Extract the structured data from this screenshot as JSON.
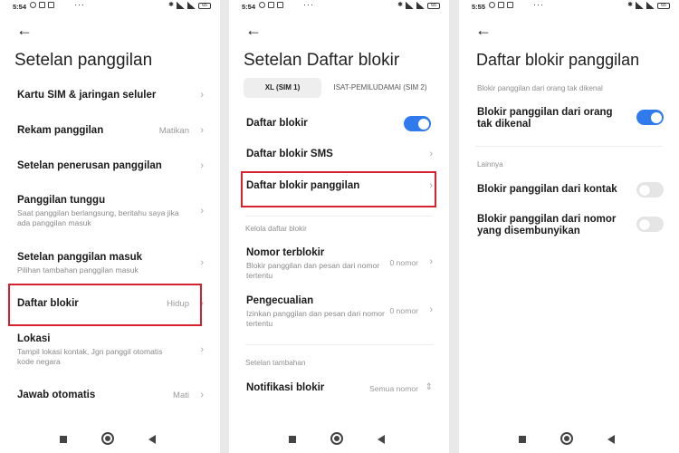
{
  "screen1": {
    "status": {
      "time": "5:54",
      "battery": "65"
    },
    "title": "Setelan panggilan",
    "items": [
      {
        "label": "Kartu SIM & jaringan seluler",
        "value": "",
        "sub": ""
      },
      {
        "label": "Rekam panggilan",
        "value": "Matikan",
        "sub": ""
      },
      {
        "label": "Setelan penerusan panggilan",
        "value": "",
        "sub": ""
      },
      {
        "label": "Panggilan tunggu",
        "value": "",
        "sub": "Saat panggilan berlangsung, beritahu saya jika ada panggilan masuk"
      },
      {
        "label": "Setelan panggilan masuk",
        "value": "",
        "sub": "Pilihan tambahan panggilan masuk"
      },
      {
        "label": "Daftar blokir",
        "value": "Hidup",
        "sub": ""
      },
      {
        "label": "Lokasi",
        "value": "",
        "sub": "Tampil lokasi kontak, Jgn panggil otomatis kode negara"
      },
      {
        "label": "Jawab otomatis",
        "value": "Mati",
        "sub": ""
      }
    ]
  },
  "screen2": {
    "status": {
      "time": "5:54",
      "battery": "65"
    },
    "title": "Setelan Daftar blokir",
    "tabs": [
      "XL (SIM 1)",
      "ISAT-PEMILUDAMAI (SIM 2)"
    ],
    "items": [
      {
        "label": "Daftar blokir",
        "value": "",
        "sub": "",
        "toggle": true
      },
      {
        "label": "Daftar blokir SMS",
        "value": "",
        "sub": ""
      },
      {
        "label": "Daftar blokir panggilan",
        "value": "",
        "sub": ""
      }
    ],
    "section1": "Kelola daftar blokir",
    "items2": [
      {
        "label": "Nomor terblokir",
        "value": "0 nomor",
        "sub": "Blokir panggilan dan pesan dari nomor tertentu"
      },
      {
        "label": "Pengecualian",
        "value": "0 nomor",
        "sub": "Izinkan panggilan dan pesan dari nomor tertentu"
      }
    ],
    "section2": "Setelan tambahan",
    "items3": [
      {
        "label": "Notifikasi blokir",
        "value": "Semua nomor",
        "sub": ""
      }
    ]
  },
  "screen3": {
    "status": {
      "time": "5:55",
      "battery": "65"
    },
    "title": "Daftar blokir panggilan",
    "section1": "Blokir panggilan dari orang tak dikenal",
    "items1": [
      {
        "label": "Blokir panggilan dari orang tak dikenal",
        "toggle": true
      }
    ],
    "section2": "Lainnya",
    "items2": [
      {
        "label": "Blokir panggilan dari kontak",
        "toggle": false
      },
      {
        "label": "Blokir panggilan dari nomor yang disembunyikan",
        "toggle": false
      }
    ]
  },
  "icons": {
    "back": "arrow-left-icon",
    "chevron": "chevron-right-icon",
    "updown": "chevron-updown-icon",
    "nav_recent": "square-icon",
    "nav_home": "circle-icon",
    "nav_back": "triangle-back-icon"
  },
  "colors": {
    "accent": "#2f7bed",
    "highlight": "#d7212f",
    "secondary_text": "#8a8a8a"
  }
}
